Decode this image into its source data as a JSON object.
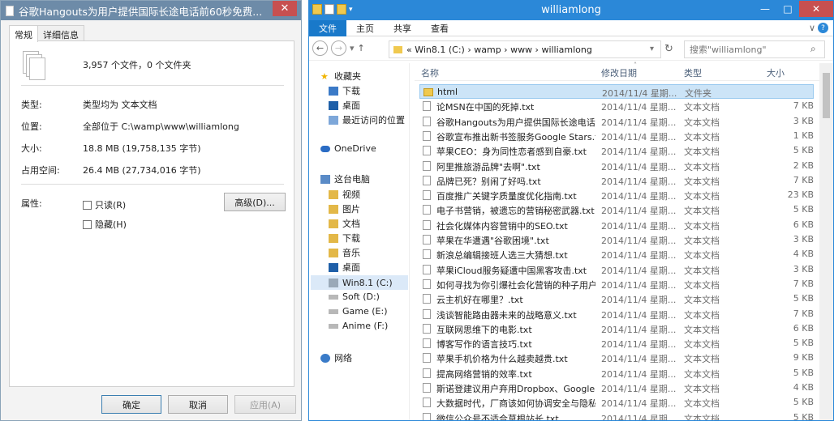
{
  "props": {
    "title": "谷歌Hangouts为用户提供国际长途电话前60秒免费...",
    "tabs": [
      "常规",
      "详细信息"
    ],
    "summary": "3,957 个文件，0 个文件夹",
    "rows": [
      {
        "label": "类型:",
        "value": "类型均为 文本文档"
      },
      {
        "label": "位置:",
        "value": "全部位于 C:\\wamp\\www\\williamlong"
      },
      {
        "label": "大小:",
        "value": "18.8 MB (19,758,135 字节)"
      },
      {
        "label": "占用空间:",
        "value": "26.4 MB (27,734,016 字节)"
      }
    ],
    "attr_label": "属性:",
    "readonly": "只读(R)",
    "hidden": "隐藏(H)",
    "advanced": "高级(D)...",
    "ok": "确定",
    "cancel": "取消",
    "apply": "应用(A)"
  },
  "explorer": {
    "title": "williamlong",
    "ribbon": [
      "文件",
      "主页",
      "共享",
      "查看"
    ],
    "address": "« Win8.1 (C:)  ›  wamp  ›  www  ›  williamlong",
    "search_placeholder": "搜索\"williamlong\"",
    "nav": {
      "favorites": "收藏夹",
      "fav_items": [
        "下载",
        "桌面",
        "最近访问的位置"
      ],
      "onedrive": "OneDrive",
      "thispc": "这台电脑",
      "pc_items": [
        "视频",
        "图片",
        "文档",
        "下载",
        "音乐",
        "桌面"
      ],
      "drives": [
        "Win8.1 (C:)",
        "Soft (D:)",
        "Game (E:)",
        "Anime (F:)"
      ],
      "network": "网络"
    },
    "columns": [
      "名称",
      "修改日期",
      "类型",
      "大小"
    ],
    "files": [
      {
        "name": "html",
        "date": "2014/11/4 星期...",
        "type": "文件夹",
        "size": "",
        "folder": true
      },
      {
        "name": "论MSN在中国的死掉.txt",
        "date": "2014/11/4 星期...",
        "type": "文本文档",
        "size": "7 KB"
      },
      {
        "name": "谷歌Hangouts为用户提供国际长途电话...",
        "date": "2014/11/4 星期...",
        "type": "文本文档",
        "size": "3 KB"
      },
      {
        "name": "谷歌宣布推出新书签服务Google Stars.t...",
        "date": "2014/11/4 星期...",
        "type": "文本文档",
        "size": "1 KB"
      },
      {
        "name": "苹果CEO：身为同性恋者感到自豪.txt",
        "date": "2014/11/4 星期...",
        "type": "文本文档",
        "size": "5 KB"
      },
      {
        "name": "阿里推旅游品牌\"去啊\".txt",
        "date": "2014/11/4 星期...",
        "type": "文本文档",
        "size": "2 KB"
      },
      {
        "name": "品牌已死？别闹了好吗.txt",
        "date": "2014/11/4 星期...",
        "type": "文本文档",
        "size": "7 KB"
      },
      {
        "name": "百度推广关键字质量度优化指南.txt",
        "date": "2014/11/4 星期...",
        "type": "文本文档",
        "size": "23 KB"
      },
      {
        "name": "电子书营销，被遗忘的营销秘密武器.txt",
        "date": "2014/11/4 星期...",
        "type": "文本文档",
        "size": "5 KB"
      },
      {
        "name": "社会化媒体内容营销中的SEO.txt",
        "date": "2014/11/4 星期...",
        "type": "文本文档",
        "size": "6 KB"
      },
      {
        "name": "苹果在华遭遇\"谷歌困境\".txt",
        "date": "2014/11/4 星期...",
        "type": "文本文档",
        "size": "3 KB"
      },
      {
        "name": "新浪总编辑接班人选三大猜想.txt",
        "date": "2014/11/4 星期...",
        "type": "文本文档",
        "size": "4 KB"
      },
      {
        "name": "苹果iCloud服务疑遭中国黑客攻击.txt",
        "date": "2014/11/4 星期...",
        "type": "文本文档",
        "size": "3 KB"
      },
      {
        "name": "如何寻找为你引爆社会化营销的种子用户...",
        "date": "2014/11/4 星期...",
        "type": "文本文档",
        "size": "7 KB"
      },
      {
        "name": "云主机好在哪里？.txt",
        "date": "2014/11/4 星期...",
        "type": "文本文档",
        "size": "5 KB"
      },
      {
        "name": "浅谈智能路由器未来的战略意义.txt",
        "date": "2014/11/4 星期...",
        "type": "文本文档",
        "size": "7 KB"
      },
      {
        "name": "互联网思维下的电影.txt",
        "date": "2014/11/4 星期...",
        "type": "文本文档",
        "size": "6 KB"
      },
      {
        "name": "博客写作的语言技巧.txt",
        "date": "2014/11/4 星期...",
        "type": "文本文档",
        "size": "5 KB"
      },
      {
        "name": "苹果手机价格为什么越卖越贵.txt",
        "date": "2014/11/4 星期...",
        "type": "文本文档",
        "size": "9 KB"
      },
      {
        "name": "提高网络营销的效率.txt",
        "date": "2014/11/4 星期...",
        "type": "文本文档",
        "size": "5 KB"
      },
      {
        "name": "斯诺登建议用户弃用Dropbox、Google...",
        "date": "2014/11/4 星期...",
        "type": "文本文档",
        "size": "4 KB"
      },
      {
        "name": "大数据时代，厂商该如何协调安全与隐私...",
        "date": "2014/11/4 星期...",
        "type": "文本文档",
        "size": "5 KB"
      },
      {
        "name": "微信公众号不适合草根站长.txt",
        "date": "2014/11/4 星期...",
        "type": "文本文档",
        "size": "5 KB"
      }
    ]
  },
  "colors": {
    "accent": "#2b88d8",
    "props_title": "#6d8ba8",
    "close": "#c75050",
    "selected": "#cce4f7"
  }
}
